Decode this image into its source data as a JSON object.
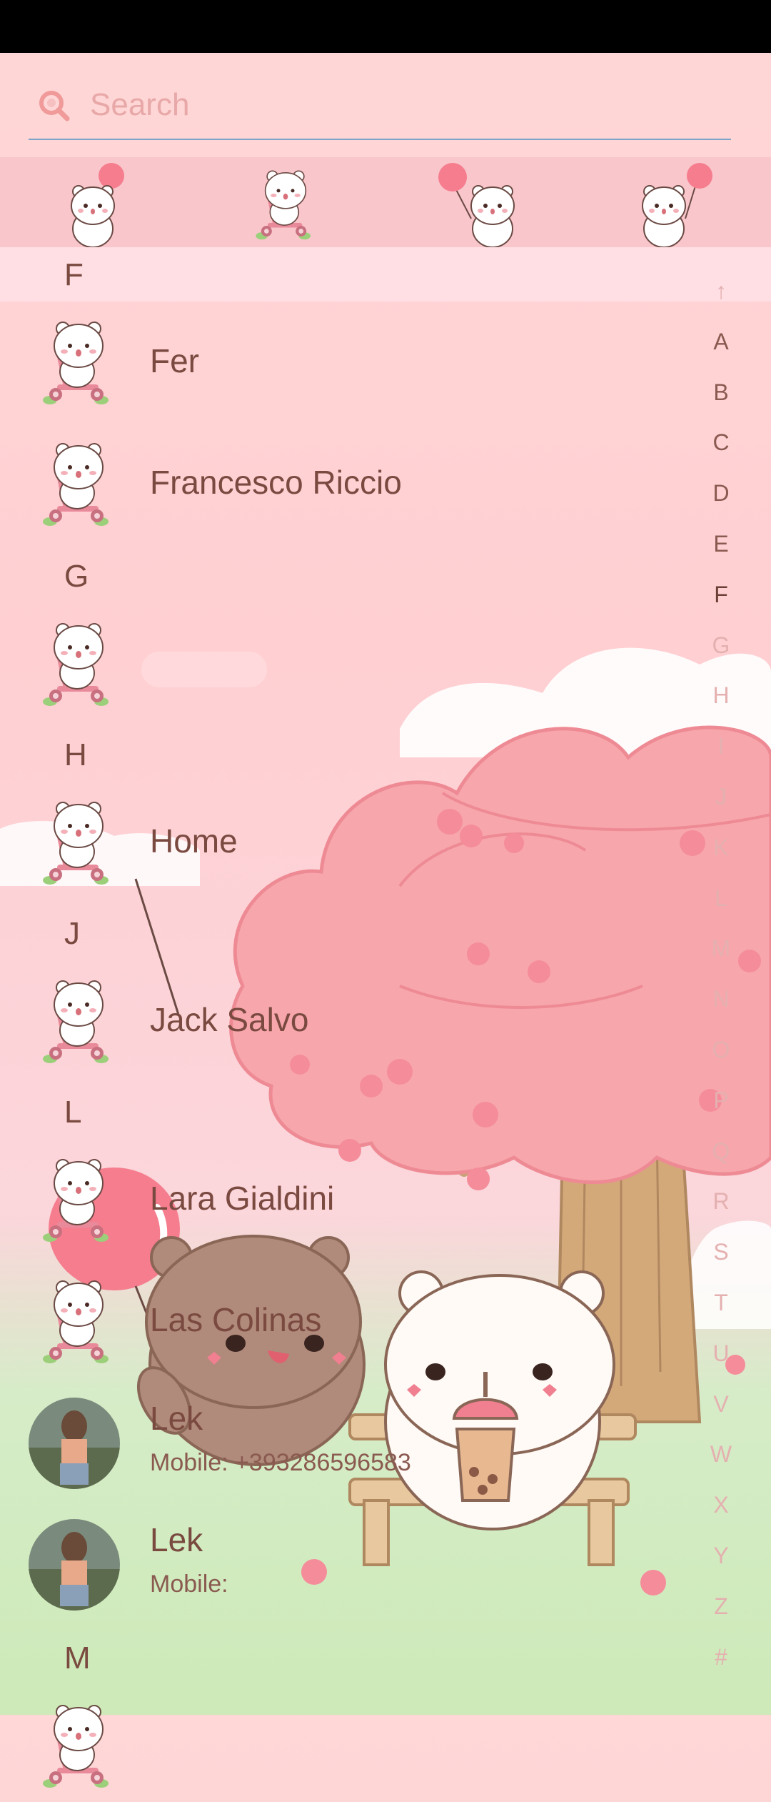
{
  "search": {
    "placeholder": "Search"
  },
  "sections": [
    {
      "letter": "F",
      "contacts": [
        {
          "name": "Fer"
        },
        {
          "name": "Francesco Riccio"
        }
      ]
    },
    {
      "letter": "G",
      "contacts": [
        {
          "name": ""
        }
      ]
    },
    {
      "letter": "H",
      "contacts": [
        {
          "name": "Home"
        }
      ]
    },
    {
      "letter": "J",
      "contacts": [
        {
          "name": "Jack Salvo"
        }
      ]
    },
    {
      "letter": "L",
      "contacts": [
        {
          "name": "Lara Gialdini"
        },
        {
          "name": "Las Colinas"
        },
        {
          "name": "Lek",
          "detail": "Mobile: +393286596583"
        },
        {
          "name": "Lek",
          "detail": "Mobile:"
        }
      ]
    },
    {
      "letter": "M",
      "contacts": []
    }
  ],
  "index": [
    "↑",
    "A",
    "B",
    "C",
    "D",
    "E",
    "F",
    "G",
    "H",
    "I",
    "J",
    "K",
    "L",
    "M",
    "N",
    "O",
    "P",
    "Q",
    "R",
    "S",
    "T",
    "U",
    "V",
    "W",
    "X",
    "Y",
    "Z",
    "#"
  ],
  "current_index": "F",
  "colors": {
    "background": "#ffd7d7",
    "accent": "#7ea3c9",
    "text": "#7a4a40",
    "index_muted": "#e4b0b0"
  },
  "icons": {
    "search": "search-icon",
    "avatar": "bear-scooter-avatar"
  }
}
